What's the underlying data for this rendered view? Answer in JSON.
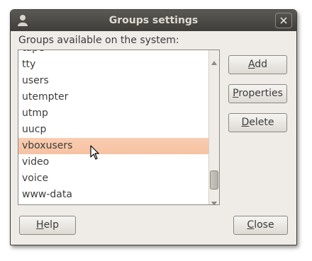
{
  "window": {
    "title": "Groups settings"
  },
  "groups_label": "Groups available on the system:",
  "groups": {
    "partial_top": "tape",
    "items": [
      "tty",
      "users",
      "utempter",
      "utmp",
      "uucp",
      "vboxusers",
      "video",
      "voice",
      "www-data"
    ],
    "selected": "vboxusers"
  },
  "buttons": {
    "add": {
      "mnemonic": "A",
      "rest": "dd"
    },
    "properties": {
      "mnemonic": "P",
      "rest": "roperties"
    },
    "delete": {
      "mnemonic": "D",
      "rest": "elete"
    },
    "help": {
      "mnemonic": "H",
      "rest": "elp"
    },
    "close": {
      "mnemonic": "C",
      "rest": "lose"
    }
  },
  "colors": {
    "selection": "#f6c2a2",
    "titlebar": "#3f3e3a",
    "window_bg": "#efebe7"
  }
}
